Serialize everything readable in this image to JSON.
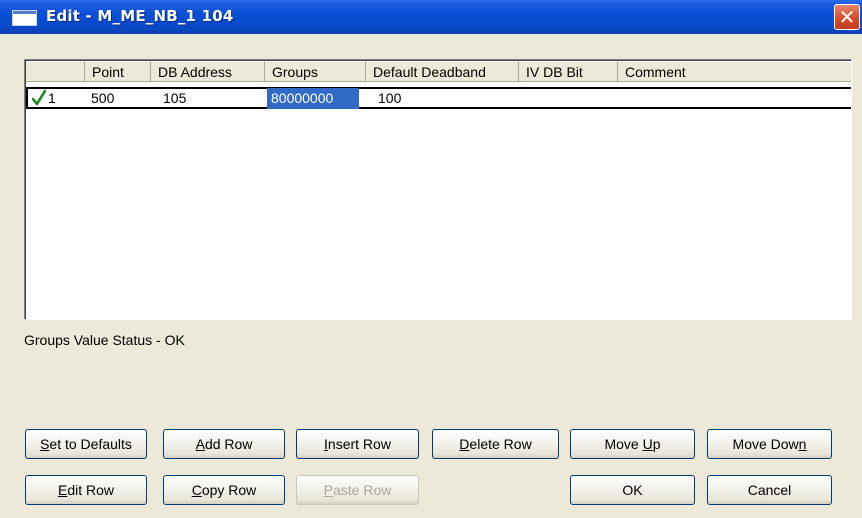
{
  "window": {
    "title": "Edit - M_ME_NB_1 104",
    "close_symbol": "✕"
  },
  "grid": {
    "columns": [
      "",
      "Point",
      "DB Address",
      "Groups",
      "Default Deadband",
      "IV DB Bit",
      "Comment"
    ],
    "rows": [
      {
        "status_icon": "checkmark-icon",
        "index": "1",
        "point": "500",
        "db_address": "105",
        "groups": "80000000",
        "default_deadband": "100",
        "iv_db_bit": "",
        "comment": ""
      }
    ]
  },
  "status_text": "Groups Value Status - OK",
  "buttons": {
    "set_defaults": {
      "pre": "",
      "key": "S",
      "post": "et to Defaults"
    },
    "add_row": {
      "pre": "",
      "key": "A",
      "post": "dd Row"
    },
    "insert_row": {
      "pre": "",
      "key": "I",
      "post": "nsert Row"
    },
    "delete_row": {
      "pre": "",
      "key": "D",
      "post": "elete Row"
    },
    "move_up": {
      "pre": "Move ",
      "key": "U",
      "post": "p"
    },
    "move_down": {
      "pre": "Move Dow",
      "key": "n",
      "post": ""
    },
    "edit_row": {
      "pre": "",
      "key": "E",
      "post": "dit Row"
    },
    "copy_row": {
      "pre": "",
      "key": "C",
      "post": "opy Row"
    },
    "paste_row": {
      "pre": "",
      "key": "P",
      "post": "aste Row"
    },
    "ok": {
      "pre": "OK",
      "key": "",
      "post": ""
    },
    "cancel": {
      "pre": "Cancel",
      "key": "",
      "post": ""
    }
  },
  "colors": {
    "title_bar": "#0a4fd6",
    "selection": "#316ac5",
    "checkmark": "#1a8a1a",
    "face": "#ece9d8"
  }
}
